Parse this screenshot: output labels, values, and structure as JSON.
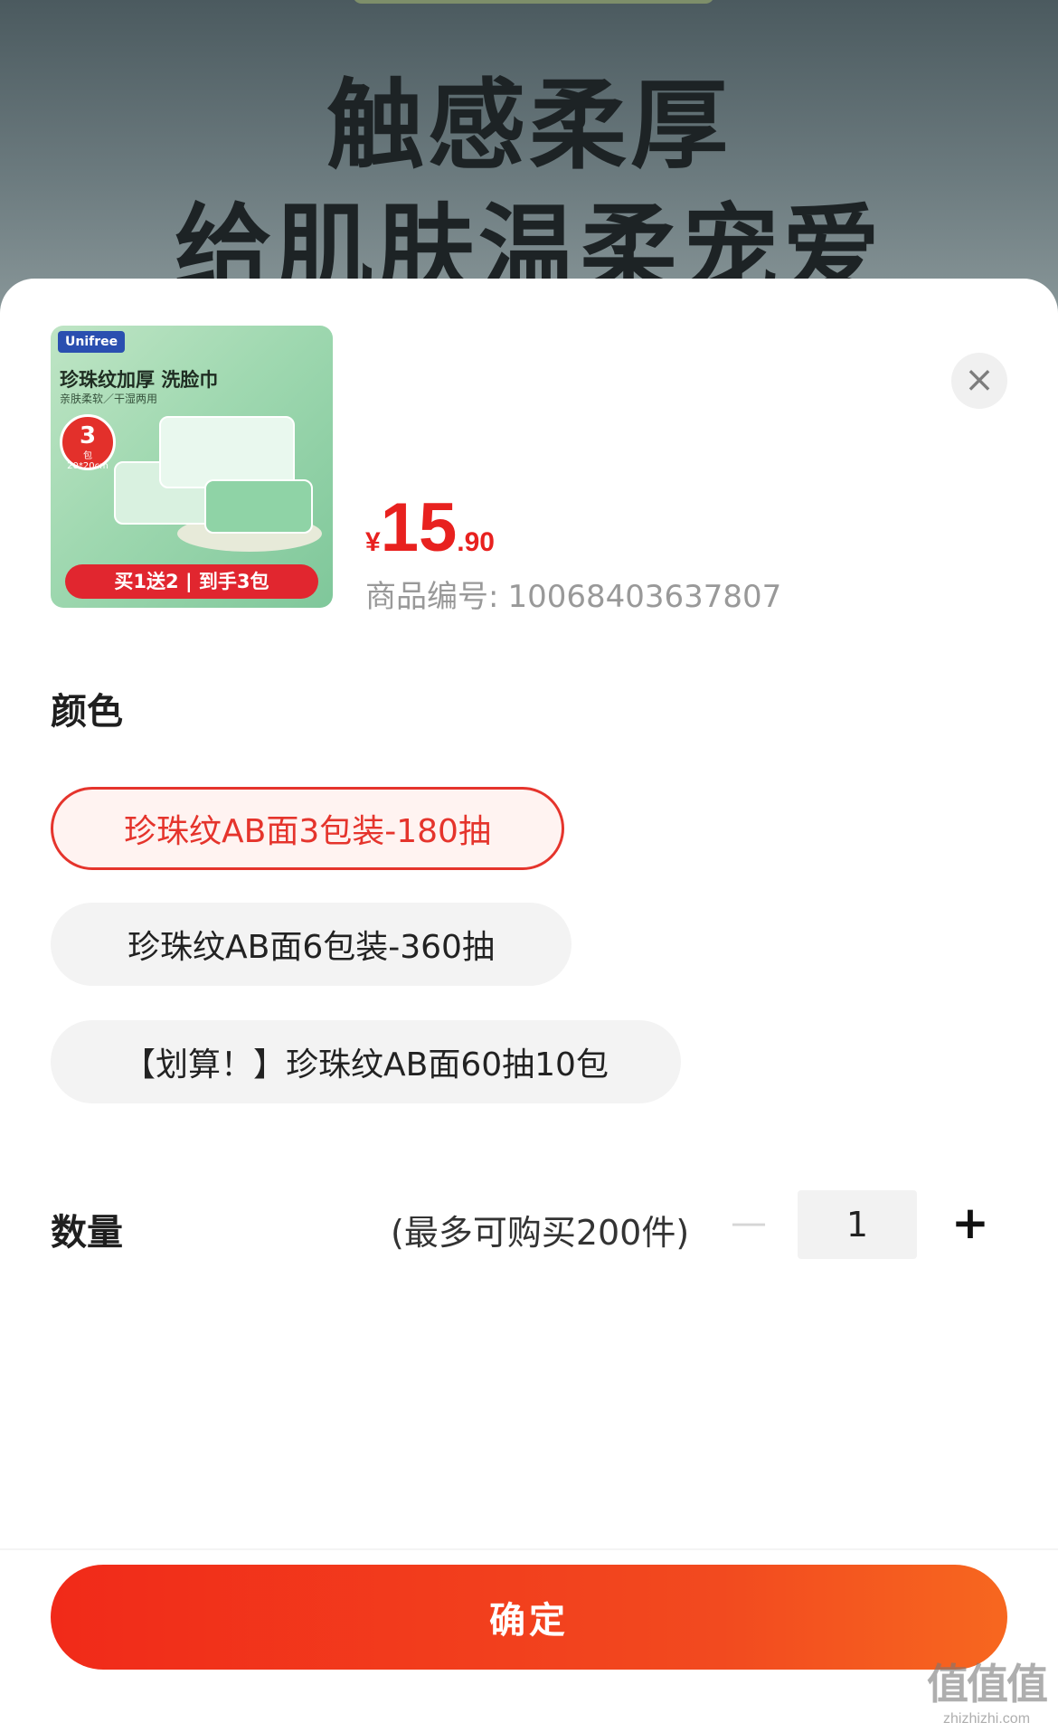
{
  "banner": {
    "line1": "触感柔厚",
    "line2": "给肌肤温柔宠爱"
  },
  "product": {
    "image": {
      "brand": "Unifree",
      "title": "珍珠纹加厚 洗脸巾",
      "subtitle": "亲肤柔软／干湿两用",
      "badge_count": "3",
      "badge_unit": "包",
      "badge_size": "20*20cm",
      "promo": "买1送2 | 到手3包"
    },
    "price": {
      "currency": "¥",
      "integer": "15",
      "decimal": ".90"
    },
    "sku_label": "商品编号:",
    "sku_number": "10068403637807"
  },
  "close_icon": "×",
  "color_section": {
    "title": "颜色",
    "options": [
      {
        "label": "珍珠纹AB面3包装-180抽",
        "selected": true
      },
      {
        "label": "珍珠纹AB面6包装-360抽",
        "selected": false
      },
      {
        "label": "【划算！】珍珠纹AB面60抽10包",
        "selected": false
      }
    ]
  },
  "quantity": {
    "title": "数量",
    "limit_text": "(最多可购买200件)",
    "minus": "—",
    "value": "1",
    "plus": "+"
  },
  "confirm_label": "确定",
  "watermark": {
    "mark": "值值值",
    "url": "zhizhizhi.com"
  },
  "colors": {
    "accent": "#e5342c",
    "price": "#e8211f",
    "button_start": "#f12a19",
    "button_end": "#f7671f"
  }
}
